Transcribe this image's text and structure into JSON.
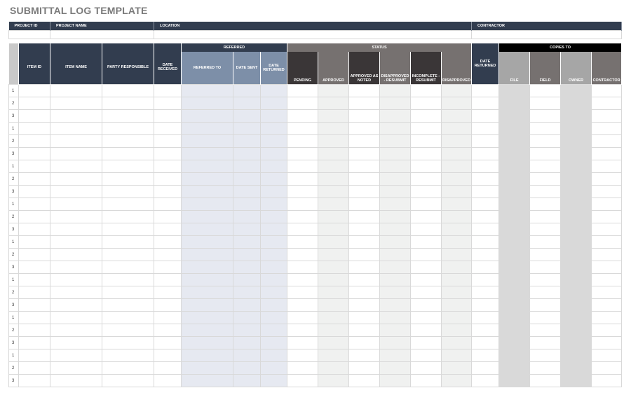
{
  "title": "SUBMITTAL LOG TEMPLATE",
  "info_headers": [
    "PROJECT ID",
    "PROJECT NAME",
    "LOCATION",
    "CONTRACTOR"
  ],
  "groups": {
    "referred": "REFERRED",
    "status": "STATUS",
    "copies": "COPIES TO"
  },
  "columns": {
    "item_id": "ITEM ID",
    "item_name": "ITEM NAME",
    "party": "PARTY RESPONSIBLE",
    "date_received": "DATE RECEIVED",
    "referred_to": "REFERRED TO",
    "date_sent": "DATE SENT",
    "date_returned_ref": "DATE RETURNED",
    "pending": "PENDING",
    "approved": "APPROVED",
    "approved_noted": "APPROVED AS NOTED",
    "disapproved_resubmit": "DISAPPROVED - RESUBMIT",
    "incomplete_resubmit": "INCOMPLETE - RESUBMIT",
    "disapproved": "DISAPPROVED",
    "date_returned": "DATE RETURNED",
    "file": "FILE",
    "field": "FIELD",
    "owner": "OWNER",
    "contractor": "CONTRACTOR"
  },
  "row_numbers": [
    "1",
    "2",
    "3",
    "1",
    "2",
    "3",
    "1",
    "2",
    "3",
    "1",
    "2",
    "3",
    "1",
    "2",
    "3",
    "1",
    "2",
    "3",
    "1",
    "2",
    "3",
    "1",
    "2",
    "3"
  ]
}
